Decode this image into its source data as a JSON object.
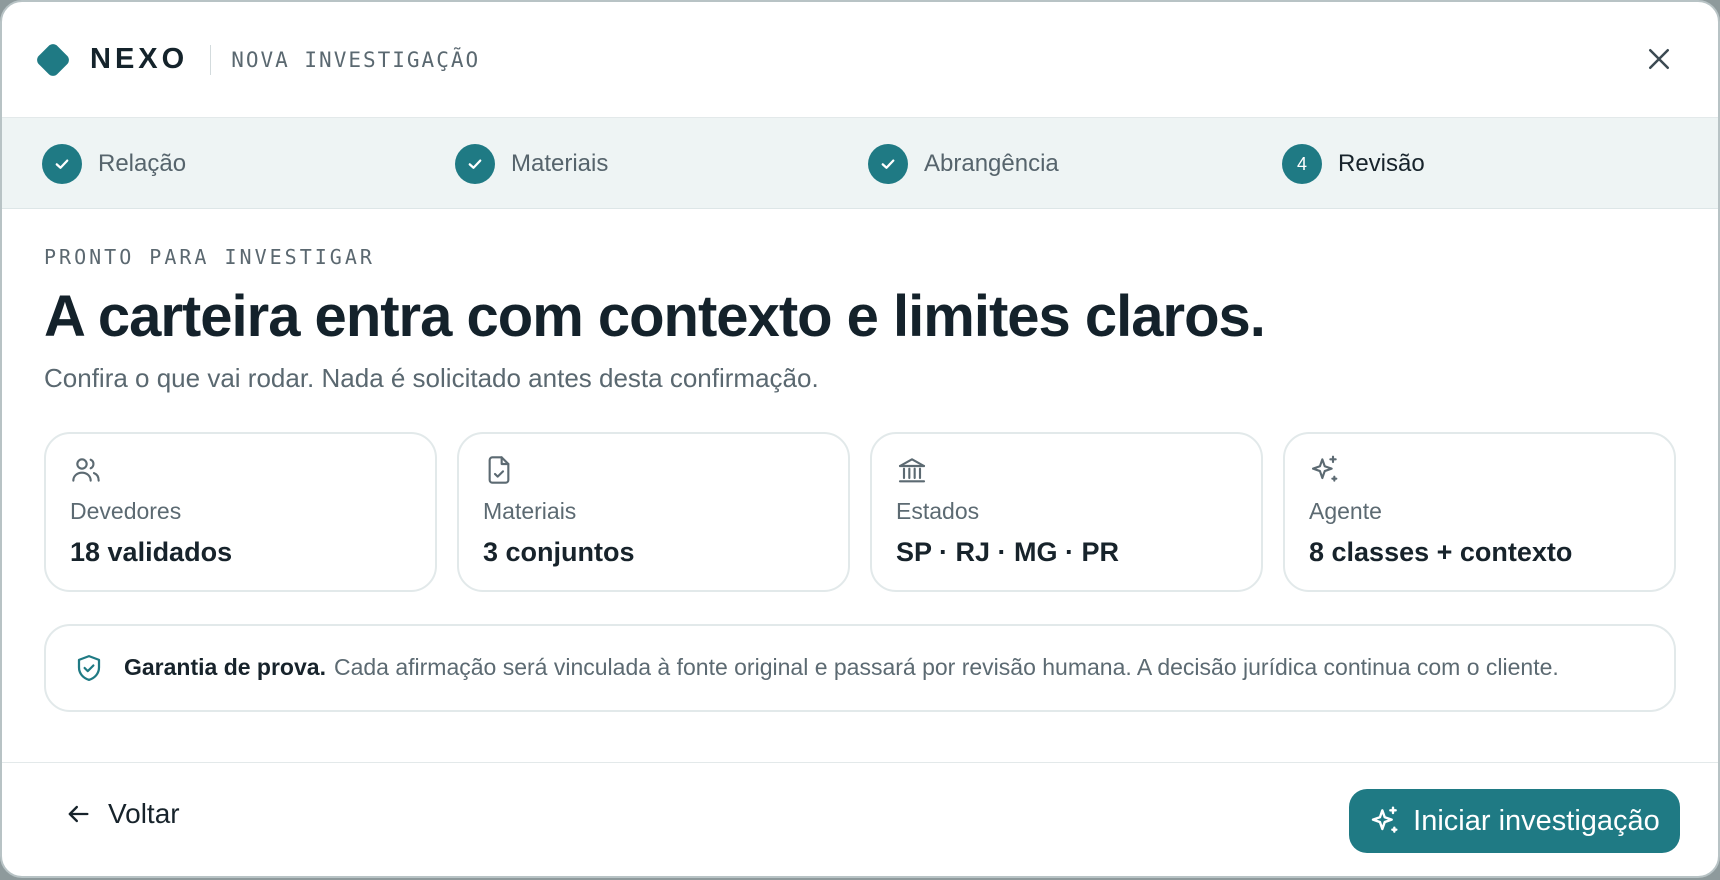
{
  "header": {
    "brand": "NEXO",
    "subtitle": "NOVA INVESTIGAÇÃO",
    "close_icon": "close-icon"
  },
  "steps": [
    {
      "label": "Relação",
      "state": "done",
      "icon": "check-icon"
    },
    {
      "label": "Materiais",
      "state": "done",
      "icon": "check-icon"
    },
    {
      "label": "Abrangência",
      "state": "done",
      "icon": "check-icon"
    },
    {
      "label": "Revisão",
      "state": "active",
      "number": "4"
    }
  ],
  "main": {
    "eyebrow": "PRONTO PARA INVESTIGAR",
    "headline": "A carteira entra com contexto e limites claros.",
    "subtitle": "Confira o que vai rodar. Nada é solicitado antes desta confirmação.",
    "cards": [
      {
        "icon": "users-icon",
        "label": "Devedores",
        "value": "18 validados"
      },
      {
        "icon": "file-check-icon",
        "label": "Materiais",
        "value": "3 conjuntos"
      },
      {
        "icon": "bank-icon",
        "label": "Estados",
        "value": "SP · RJ · MG · PR"
      },
      {
        "icon": "sparkles-icon",
        "label": "Agente",
        "value": "8 classes + contexto"
      }
    ],
    "guarantee": {
      "icon": "shield-check-icon",
      "title": "Garantia de prova.",
      "text": "Cada afirmação será vinculada à fonte original e passará por revisão humana. A decisão jurídica continua com o cliente."
    }
  },
  "footer": {
    "back_label": "Voltar",
    "back_icon": "arrow-left-icon",
    "start_label": "Iniciar investigação",
    "start_icon": "sparkles-icon"
  },
  "colors": {
    "accent": "#1f7a84",
    "steps_bg": "#eef4f4",
    "text": "#17232b",
    "muted": "#5c6a72"
  }
}
